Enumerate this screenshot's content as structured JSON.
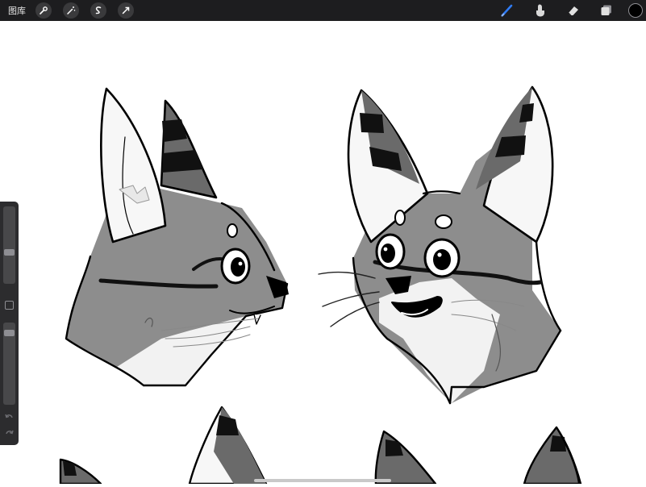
{
  "toolbar": {
    "gallery_label": "图库",
    "left_tools": [
      "wrench-icon",
      "magic-wand-icon",
      "selection-icon",
      "transform-icon"
    ],
    "right_tools": [
      "brush-icon",
      "smudge-icon",
      "eraser-icon",
      "layers-icon"
    ],
    "active_tool": "brush-icon",
    "brush_color": "#2f7bf5",
    "current_color": "#000000"
  },
  "sidebar": {
    "brush_size": 0.4,
    "opacity": 0.1
  }
}
